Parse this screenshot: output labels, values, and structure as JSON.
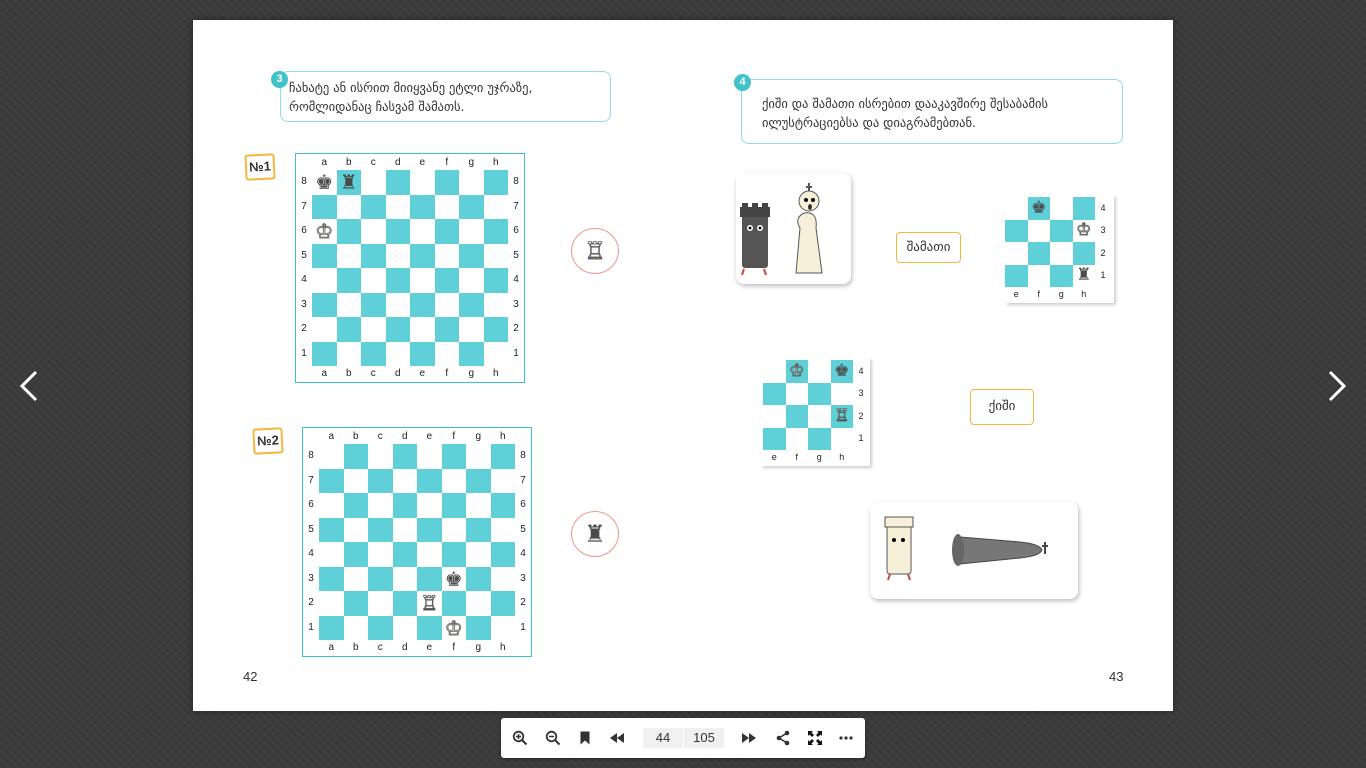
{
  "viewer": {
    "toolbar": {
      "current_page": "44",
      "total_pages": "105",
      "buttons": [
        "zoom-in-icon",
        "zoom-out-icon",
        "bookmark-icon",
        "first-page-icon",
        "last-page-icon",
        "share-icon",
        "fullscreen-icon",
        "more-icon"
      ]
    },
    "nav": {
      "prev_icon": "chevron-left-icon",
      "next_icon": "chevron-right-icon"
    }
  },
  "left_page": {
    "page_number": "42",
    "task": {
      "number": "3",
      "text": "ჩახატე ან ისრით მიიყვანე ეტლი უჯრაზე,\nრომლიდანაც ჩასვამ შამათს."
    },
    "files": [
      "a",
      "b",
      "c",
      "d",
      "e",
      "f",
      "g",
      "h"
    ],
    "ranks": [
      "8",
      "7",
      "6",
      "5",
      "4",
      "3",
      "2",
      "1"
    ],
    "boards": [
      {
        "label": "№1",
        "pieces": [
          {
            "square": "a8",
            "symbol": "♚",
            "color": "black"
          },
          {
            "square": "b8",
            "symbol": "♜",
            "color": "black"
          },
          {
            "square": "a6",
            "symbol": "♔",
            "color": "white"
          }
        ],
        "circle_piece": {
          "symbol": "♖",
          "color": "white"
        }
      },
      {
        "label": "№2",
        "pieces": [
          {
            "square": "f3",
            "symbol": "♚",
            "color": "black"
          },
          {
            "square": "e2",
            "symbol": "♖",
            "color": "white"
          },
          {
            "square": "f1",
            "symbol": "♔",
            "color": "white"
          }
        ],
        "circle_piece": {
          "symbol": "♜",
          "color": "black"
        }
      }
    ]
  },
  "right_page": {
    "page_number": "43",
    "task": {
      "number": "4",
      "text": "ქიში და შამათი ისრებით დააკავშირე შესაბამის\nილუსტრაციებსა და დიაგრამებთან."
    },
    "words": [
      "შამათი",
      "ქიში"
    ],
    "mini_files": [
      "e",
      "f",
      "g",
      "h"
    ],
    "mini_ranks": [
      "4",
      "3",
      "2",
      "1"
    ],
    "mini_boards": [
      {
        "pieces": [
          {
            "square": "f4",
            "symbol": "♚",
            "color": "black"
          },
          {
            "square": "h3",
            "symbol": "♔",
            "color": "white"
          },
          {
            "square": "h1",
            "symbol": "♜",
            "color": "black"
          }
        ]
      },
      {
        "pieces": [
          {
            "square": "f4",
            "symbol": "♔",
            "color": "white"
          },
          {
            "square": "h4",
            "symbol": "♚",
            "color": "black"
          },
          {
            "square": "h2",
            "symbol": "♖",
            "color": "white"
          }
        ]
      }
    ],
    "illustrations": [
      {
        "name": "black-rook-and-white-king-illustration"
      },
      {
        "name": "white-rook-and-fallen-black-king-illustration"
      }
    ]
  },
  "colors": {
    "board_dark": "#5fd0d8",
    "task_accent": "#3fc3c9",
    "label_border": "#f4b63d",
    "circle_border": "#f0948d",
    "background": "#3b3b3b"
  }
}
